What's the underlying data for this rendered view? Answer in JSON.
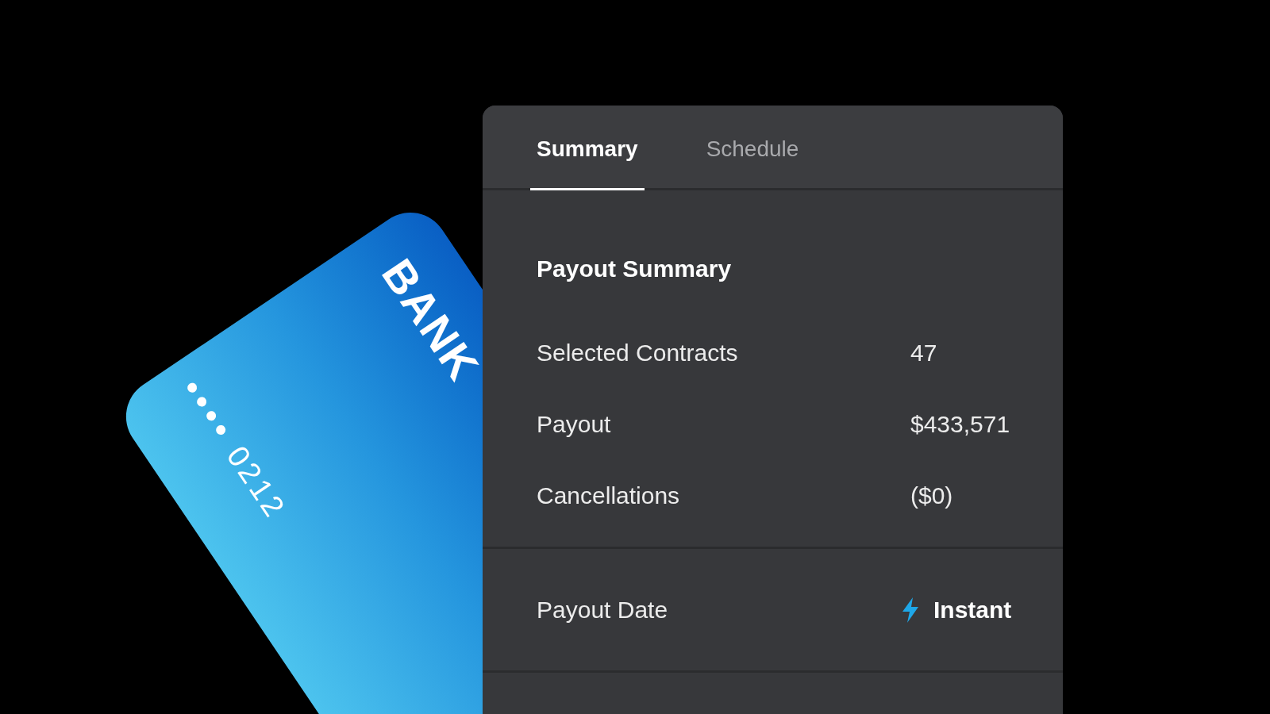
{
  "card": {
    "bank_name": "BANK",
    "mask": "••••",
    "last4": "0212"
  },
  "tabs": [
    {
      "label": "Summary",
      "selected": true
    },
    {
      "label": "Schedule",
      "selected": false
    }
  ],
  "summary": {
    "title": "Payout Summary",
    "rows": [
      {
        "label": "Selected Contracts",
        "value": "47"
      },
      {
        "label": "Payout",
        "value": "$433,571"
      },
      {
        "label": "Cancellations",
        "value": "($0)"
      }
    ]
  },
  "payout_date": {
    "label": "Payout Date",
    "value": "Instant"
  }
}
